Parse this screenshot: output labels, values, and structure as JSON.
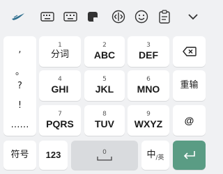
{
  "toolbar": {
    "icons": [
      "swift-logo-icon",
      "keyboard-icon",
      "keyboard-alt-icon",
      "sticker-icon",
      "cursor-move-icon",
      "emoji-icon",
      "clipboard-icon",
      "chevron-down-icon"
    ]
  },
  "punctuation": [
    ",",
    "。",
    "?",
    "!",
    "……"
  ],
  "keys": {
    "k1": {
      "num": "1",
      "label": "分词"
    },
    "k2": {
      "num": "2",
      "label": "ABC"
    },
    "k3": {
      "num": "3",
      "label": "DEF"
    },
    "k4": {
      "num": "4",
      "label": "GHI"
    },
    "k5": {
      "num": "5",
      "label": "JKL"
    },
    "k6": {
      "num": "6",
      "label": "MNO"
    },
    "k7": {
      "num": "7",
      "label": "PQRS"
    },
    "k8": {
      "num": "8",
      "label": "TUV"
    },
    "k9": {
      "num": "9",
      "label": "WXYZ"
    },
    "k0": {
      "num": "0",
      "label": "___"
    }
  },
  "side_keys": {
    "backspace": "⌫",
    "retype": "重输",
    "at": "@"
  },
  "bottom_row": {
    "symbols": "符号",
    "numbers": "123",
    "lang_main": "中",
    "lang_sub": "/英",
    "enter": "↵"
  },
  "colors": {
    "background": "#f0f1f3",
    "key": "#ffffff",
    "space_key": "#d9dbde",
    "enter_key": "#5a9c84"
  }
}
